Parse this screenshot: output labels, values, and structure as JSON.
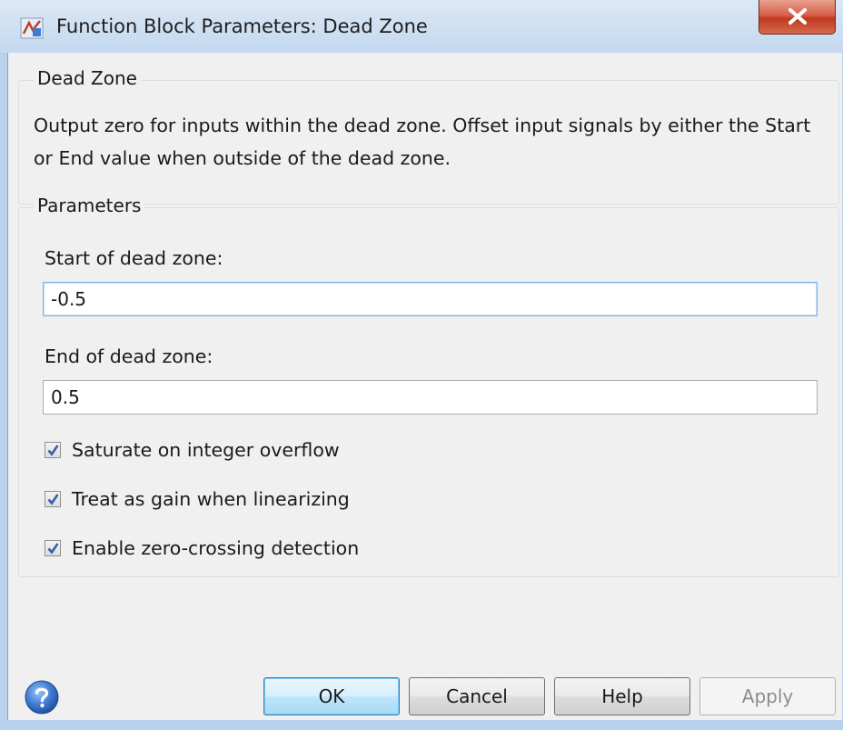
{
  "window": {
    "title": "Function Block Parameters: Dead Zone",
    "close_symbol": "X"
  },
  "block_group": {
    "legend": "Dead Zone",
    "description": "Output zero for inputs within the dead zone.  Offset input signals by either the Start or End value when outside of the dead zone."
  },
  "parameters": {
    "legend": "Parameters",
    "start_label": "Start of dead zone:",
    "start_value": "-0.5",
    "end_label": "End of dead zone:",
    "end_value": "0.5",
    "checkboxes": [
      {
        "label": "Saturate on integer overflow",
        "checked": true
      },
      {
        "label": "Treat as gain when linearizing",
        "checked": true
      },
      {
        "label": "Enable zero-crossing detection",
        "checked": true
      }
    ]
  },
  "buttons": {
    "ok": "OK",
    "cancel": "Cancel",
    "help": "Help",
    "apply": "Apply"
  },
  "icons": {
    "app": "simulink-block-icon",
    "close": "close-icon",
    "help": "help-question-icon",
    "check": "checkmark-icon"
  },
  "colors": {
    "titlebar": "#c4d8ee",
    "close_button": "#c0381f",
    "dialog_background": "#f0f0f0",
    "default_button_border": "#3c7fb1",
    "checkmark": "#3a5ea8"
  }
}
